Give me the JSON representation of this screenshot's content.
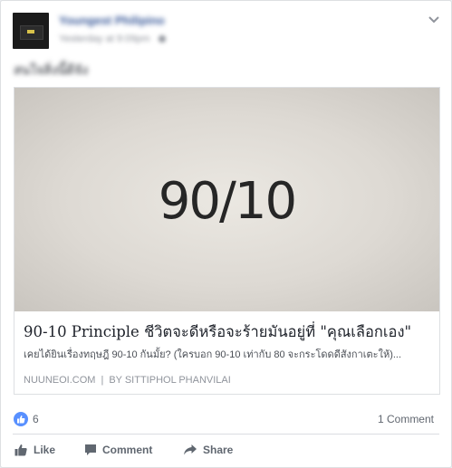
{
  "post": {
    "author_name": "Youngest Philipino",
    "timestamp": "Yesterday at 9:09pm",
    "status_text": "สนใจสิ่งนี้ดีจัง",
    "menu_icon": "chevron-down-icon"
  },
  "link": {
    "image_text": "90/10",
    "title": "90-10 Principle ชีวิตจะดีหรือจะร้ายมันอยู่ที่ \"คุณเลือกเอง\"",
    "description": "เคยได้ยินเรื่องทฤษฎี 90-10 กันมั้ย? (ใครบอก 90-10 เท่ากับ 80 จะกระโดดดีสังกาเตะให้)...",
    "domain": "NUUNEOI.COM",
    "separator": "|",
    "byline": "BY SITTIPHOL PHANVILAI"
  },
  "stats": {
    "reaction_count": "6",
    "comment_count": "1 Comment"
  },
  "actions": {
    "like_label": "Like",
    "comment_label": "Comment",
    "share_label": "Share"
  },
  "colors": {
    "link_blue": "#385898",
    "like_badge": "#5890ff",
    "meta_gray": "#90949c"
  }
}
